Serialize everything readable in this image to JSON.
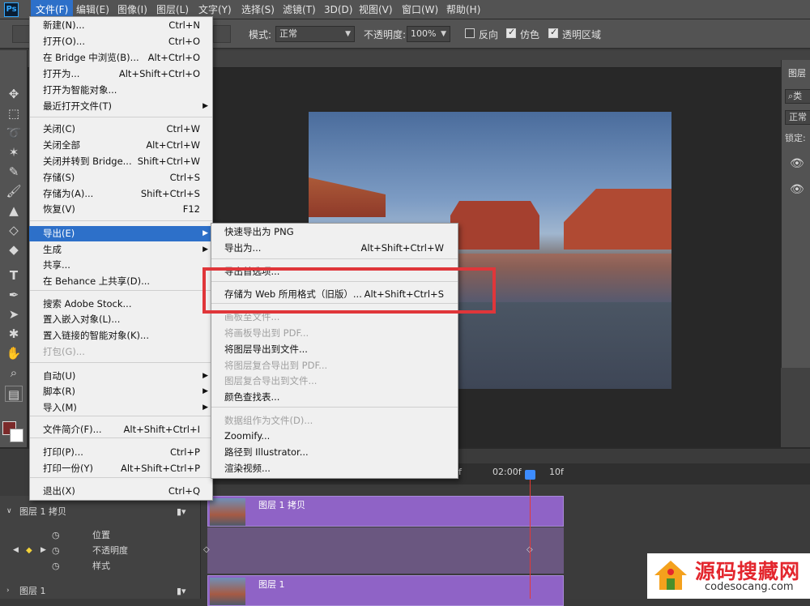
{
  "menubar": {
    "logo": "Ps",
    "items": [
      "文件(F)",
      "编辑(E)",
      "图像(I)",
      "图层(L)",
      "文字(Y)",
      "选择(S)",
      "滤镜(T)",
      "3D(D)",
      "视图(V)",
      "窗口(W)",
      "帮助(H)"
    ]
  },
  "options": {
    "mode_label": "模式:",
    "mode_value": "正常",
    "opacity_label": "不透明度:",
    "opacity_value": "100%",
    "reverse_label": "反向",
    "dither_label": "仿色",
    "transparency_label": "透明区域",
    "reverse_checked": false,
    "dither_checked": true,
    "transparency_checked": true
  },
  "panels": {
    "layers_title": "图层",
    "search_prefix": "类",
    "blend_mode": "正常",
    "lock_label": "锁定:"
  },
  "file_menu": [
    {
      "label": "新建(N)...",
      "shortcut": "Ctrl+N"
    },
    {
      "label": "打开(O)...",
      "shortcut": "Ctrl+O"
    },
    {
      "label": "在 Bridge 中浏览(B)...",
      "shortcut": "Alt+Ctrl+O"
    },
    {
      "label": "打开为...",
      "shortcut": "Alt+Shift+Ctrl+O"
    },
    {
      "label": "打开为智能对象...",
      "shortcut": ""
    },
    {
      "label": "最近打开文件(T)",
      "shortcut": ""
    },
    {
      "label": "关闭(C)",
      "shortcut": "Ctrl+W"
    },
    {
      "label": "关闭全部",
      "shortcut": "Alt+Ctrl+W"
    },
    {
      "label": "关闭并转到 Bridge...",
      "shortcut": "Shift+Ctrl+W"
    },
    {
      "label": "存储(S)",
      "shortcut": "Ctrl+S"
    },
    {
      "label": "存储为(A)...",
      "shortcut": "Shift+Ctrl+S"
    },
    {
      "label": "恢复(V)",
      "shortcut": "F12"
    },
    {
      "label": "导出(E)",
      "shortcut": ""
    },
    {
      "label": "生成",
      "shortcut": ""
    },
    {
      "label": "共享...",
      "shortcut": ""
    },
    {
      "label": "在 Behance 上共享(D)...",
      "shortcut": ""
    },
    {
      "label": "搜索 Adobe Stock...",
      "shortcut": ""
    },
    {
      "label": "置入嵌入对象(L)...",
      "shortcut": ""
    },
    {
      "label": "置入链接的智能对象(K)...",
      "shortcut": ""
    },
    {
      "label": "打包(G)...",
      "shortcut": ""
    },
    {
      "label": "自动(U)",
      "shortcut": ""
    },
    {
      "label": "脚本(R)",
      "shortcut": ""
    },
    {
      "label": "导入(M)",
      "shortcut": ""
    },
    {
      "label": "文件简介(F)...",
      "shortcut": "Alt+Shift+Ctrl+I"
    },
    {
      "label": "打印(P)...",
      "shortcut": "Ctrl+P"
    },
    {
      "label": "打印一份(Y)",
      "shortcut": "Alt+Shift+Ctrl+P"
    },
    {
      "label": "退出(X)",
      "shortcut": "Ctrl+Q"
    }
  ],
  "export_menu": [
    {
      "label": "快速导出为 PNG",
      "shortcut": ""
    },
    {
      "label": "导出为...",
      "shortcut": "Alt+Shift+Ctrl+W"
    },
    {
      "label": "导出首选项...",
      "shortcut": ""
    },
    {
      "label": "存储为 Web 所用格式（旧版）...",
      "shortcut": "Alt+Shift+Ctrl+S"
    },
    {
      "label": "画板至文件...",
      "shortcut": ""
    },
    {
      "label": "将画板导出到 PDF...",
      "shortcut": ""
    },
    {
      "label": "将图层导出到文件...",
      "shortcut": ""
    },
    {
      "label": "将图层复合导出到 PDF...",
      "shortcut": ""
    },
    {
      "label": "图层复合导出到文件...",
      "shortcut": ""
    },
    {
      "label": "颜色查找表...",
      "shortcut": ""
    },
    {
      "label": "数据组作为文件(D)...",
      "shortcut": ""
    },
    {
      "label": "Zoomify...",
      "shortcut": ""
    },
    {
      "label": "路径到 Illustrator...",
      "shortcut": ""
    },
    {
      "label": "渲染视频...",
      "shortcut": ""
    }
  ],
  "timeline": {
    "ticks": [
      "f",
      "02:00f",
      "10f"
    ],
    "layer1_copy": "图层 1 拷贝",
    "prop_position": "位置",
    "prop_opacity": "不透明度",
    "prop_style": "样式",
    "layer1": "图层 1",
    "clip1_label": "图层 1 拷贝",
    "clip2_label": "图层 1"
  },
  "watermark": {
    "title": "源码搜藏网",
    "url": "codesocang.com"
  }
}
